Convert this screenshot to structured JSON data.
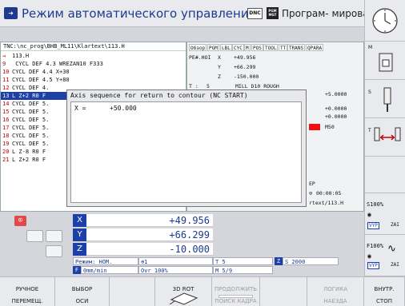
{
  "header": {
    "mode_title": "Режим автоматического управления",
    "dnc_label": "DNC",
    "pgm_badge": "PGM MGT",
    "sub_title": "Програм- мирован…"
  },
  "program": {
    "path": "TNC:\\nc_prog\\BHB_ML11\\Klartext\\113.H",
    "lines": [
      {
        "n": "→",
        "text": "113.H"
      },
      {
        "n": "9",
        "text": " CYCL DEF 4.3 WREZAN10 F333"
      },
      {
        "n": "10",
        "text": "CYCL DEF 4.4 X+30"
      },
      {
        "n": "11",
        "text": "CYCL DEF 4.5 Y+80"
      },
      {
        "n": "12",
        "text": "CYCL DEF 4."
      },
      {
        "n": "13",
        "text": "L  Z+2 R0 F"
      },
      {
        "n": "14",
        "text": "CYCL DEF 5."
      },
      {
        "n": "15",
        "text": "CYCL DEF 5."
      },
      {
        "n": "16",
        "text": "CYCL DEF 5."
      },
      {
        "n": "17",
        "text": "CYCL DEF 5."
      },
      {
        "n": "18",
        "text": "CYCL DEF 5."
      },
      {
        "n": "19",
        "text": "CYCL DEF 5."
      },
      {
        "n": "20",
        "text": "L  Z-8 R0 F"
      },
      {
        "n": "21",
        "text": "L  Z+2 R0 F"
      }
    ]
  },
  "status": {
    "tabs": [
      "Обзор",
      "PGM",
      "LBL",
      "CYC",
      "M",
      "POS",
      "TOOL",
      "TT",
      "TRANS",
      "QPARA"
    ],
    "pre_label": "PE#.HOI",
    "rows": [
      {
        "axis": "X",
        "value": "+49.956"
      },
      {
        "axis": "Y",
        "value": "+66.299"
      },
      {
        "axis": "Z",
        "value": "-150.000"
      }
    ],
    "tool_label": "T :",
    "tool_num": "5",
    "tool_name": "MILL D10 ROUGH",
    "right_vals": [
      "+5.0000",
      "+0.0000",
      "+0.0000"
    ],
    "m_code": "M50",
    "stop_label": "EP",
    "timer": "00:00:05",
    "path_tail": "rtext/113.H"
  },
  "dialog": {
    "title": "Axis sequence for return to contour (NC START)",
    "axis": "X =",
    "value": "+50.000"
  },
  "position": {
    "axes": [
      {
        "label": "X",
        "value": "+49.956"
      },
      {
        "label": "Y",
        "value": "+66.299"
      },
      {
        "label": "Z",
        "value": "-10.000"
      }
    ],
    "mode": "Режим: НОМ.",
    "t_label": "T 5",
    "s_label": "S 2000",
    "feed": "0mm/min",
    "ovr": "Ovr 100%",
    "m_label": "M 5/9",
    "spindle_num": "1"
  },
  "right_keys": {
    "m_label": "M",
    "s_label": "S",
    "t_label": "T",
    "s_override": "S100%",
    "f_override": "F100%",
    "vyp1": "VYP",
    "zap1": "ZAI",
    "vyp2": "VYP",
    "zap2": "ZAI"
  },
  "bottom_keys": [
    {
      "l1": "РУЧНОЕ",
      "l2": "ПЕРЕМЕЩ."
    },
    {
      "l1": "ВЫБОР",
      "l2": "ОСИ"
    },
    {
      "l1": "",
      "l2": ""
    },
    {
      "l1": "3D ROT",
      "l2": ""
    },
    {
      "l1": "ПРОДОЛЖИТЬ",
      "l2": "ПОИСК КАДРА"
    },
    {
      "l1": "",
      "l2": ""
    },
    {
      "l1": "ЛОГИКА",
      "l2": "НАЕЗДА"
    },
    {
      "l1": "ВНУТР.",
      "l2": "СТОП"
    }
  ],
  "colors": {
    "accent": "#1d3fa8",
    "line_numbers": "#b00000"
  }
}
